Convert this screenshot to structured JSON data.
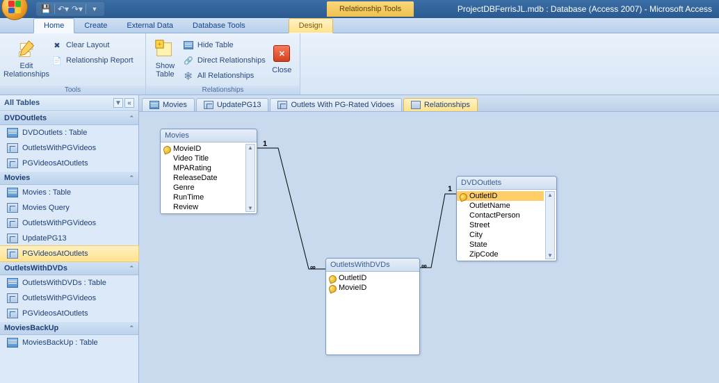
{
  "window": {
    "title": "ProjectDBFerrisJL.mdb : Database (Access 2007)  -  Microsoft Access",
    "context_title": "Relationship Tools"
  },
  "ribbon_tabs": {
    "home": "Home",
    "create": "Create",
    "external": "External Data",
    "dbtools": "Database Tools",
    "design": "Design"
  },
  "ribbon": {
    "tools": {
      "edit_rel": "Edit\nRelationships",
      "clear_layout": "Clear Layout",
      "rel_report": "Relationship Report",
      "group": "Tools"
    },
    "rel": {
      "show_table": "Show\nTable",
      "hide_table": "Hide Table",
      "direct_rel": "Direct Relationships",
      "all_rel": "All Relationships",
      "close": "Close",
      "group": "Relationships"
    }
  },
  "nav": {
    "header": "All Tables",
    "groups": [
      {
        "name": "DVDOutlets",
        "items": [
          {
            "label": "DVDOutlets : Table",
            "icon": "table"
          },
          {
            "label": "OutletsWithPGVideos",
            "icon": "query"
          },
          {
            "label": "PGVideosAtOutlets",
            "icon": "query"
          }
        ]
      },
      {
        "name": "Movies",
        "items": [
          {
            "label": "Movies : Table",
            "icon": "table"
          },
          {
            "label": "Movies Query",
            "icon": "query"
          },
          {
            "label": "OutletsWithPGVideos",
            "icon": "query"
          },
          {
            "label": "UpdatePG13",
            "icon": "query"
          },
          {
            "label": "PGVideosAtOutlets",
            "icon": "query",
            "selected": true
          }
        ]
      },
      {
        "name": "OutletsWithDVDs",
        "items": [
          {
            "label": "OutletsWithDVDs : Table",
            "icon": "table"
          },
          {
            "label": "OutletsWithPGVideos",
            "icon": "query"
          },
          {
            "label": "PGVideosAtOutlets",
            "icon": "query"
          }
        ]
      },
      {
        "name": "MoviesBackUp",
        "items": [
          {
            "label": "MoviesBackUp : Table",
            "icon": "table"
          }
        ]
      }
    ]
  },
  "doctabs": {
    "t0": "Movies",
    "t1": "UpdatePG13",
    "t2": "Outlets With PG-Rated Vidoes",
    "t3": "Relationships"
  },
  "tables": {
    "movies": {
      "title": "Movies",
      "fields": [
        "MovieID",
        "Video Title",
        "MPARating",
        "ReleaseDate",
        "Genre",
        "RunTime",
        "Review"
      ]
    },
    "owd": {
      "title": "OutletsWithDVDs",
      "fields": [
        "OutletID",
        "MovieID"
      ]
    },
    "dvdo": {
      "title": "DVDOutlets",
      "fields": [
        "OutletID",
        "OutletName",
        "ContactPerson",
        "Street",
        "City",
        "State",
        "ZipCode"
      ]
    }
  },
  "rel_labels": {
    "one": "1",
    "many": "∞"
  }
}
